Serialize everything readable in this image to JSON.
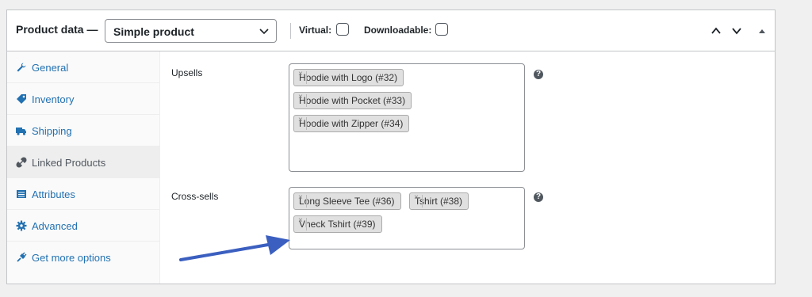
{
  "header": {
    "title": "Product data —",
    "product_type": {
      "selected": "Simple product"
    },
    "virtual_label": "Virtual:",
    "virtual_checked": false,
    "downloadable_label": "Downloadable:",
    "downloadable_checked": false,
    "icons": [
      "chevron-up-icon",
      "chevron-down-icon",
      "collapse-triangle-icon"
    ]
  },
  "sidebar": {
    "items": [
      {
        "label": "General",
        "icon": "wrench-icon",
        "active": false
      },
      {
        "label": "Inventory",
        "icon": "tag-icon",
        "active": false
      },
      {
        "label": "Shipping",
        "icon": "truck-icon",
        "active": false
      },
      {
        "label": "Linked Products",
        "icon": "link-icon",
        "active": true
      },
      {
        "label": "Attributes",
        "icon": "list-icon",
        "active": false
      },
      {
        "label": "Advanced",
        "icon": "gear-icon",
        "active": false
      },
      {
        "label": "Get more options",
        "icon": "plugin-icon",
        "active": false
      }
    ]
  },
  "main": {
    "upsells": {
      "label": "Upsells",
      "items": [
        "Hoodie with Logo (#32)",
        "Hoodie with Pocket (#33)",
        "Hoodie with Zipper (#34)"
      ]
    },
    "cross_sells": {
      "label": "Cross-sells",
      "items": [
        "Long Sleeve Tee (#36)",
        "Tshirt (#38)",
        "Vneck Tshirt (#39)"
      ]
    },
    "help_symbol": "?",
    "remove_symbol": "×"
  },
  "colors": {
    "link": "#2271b1",
    "arrow": "#3b5fc0",
    "border": "#c3c4c7"
  }
}
